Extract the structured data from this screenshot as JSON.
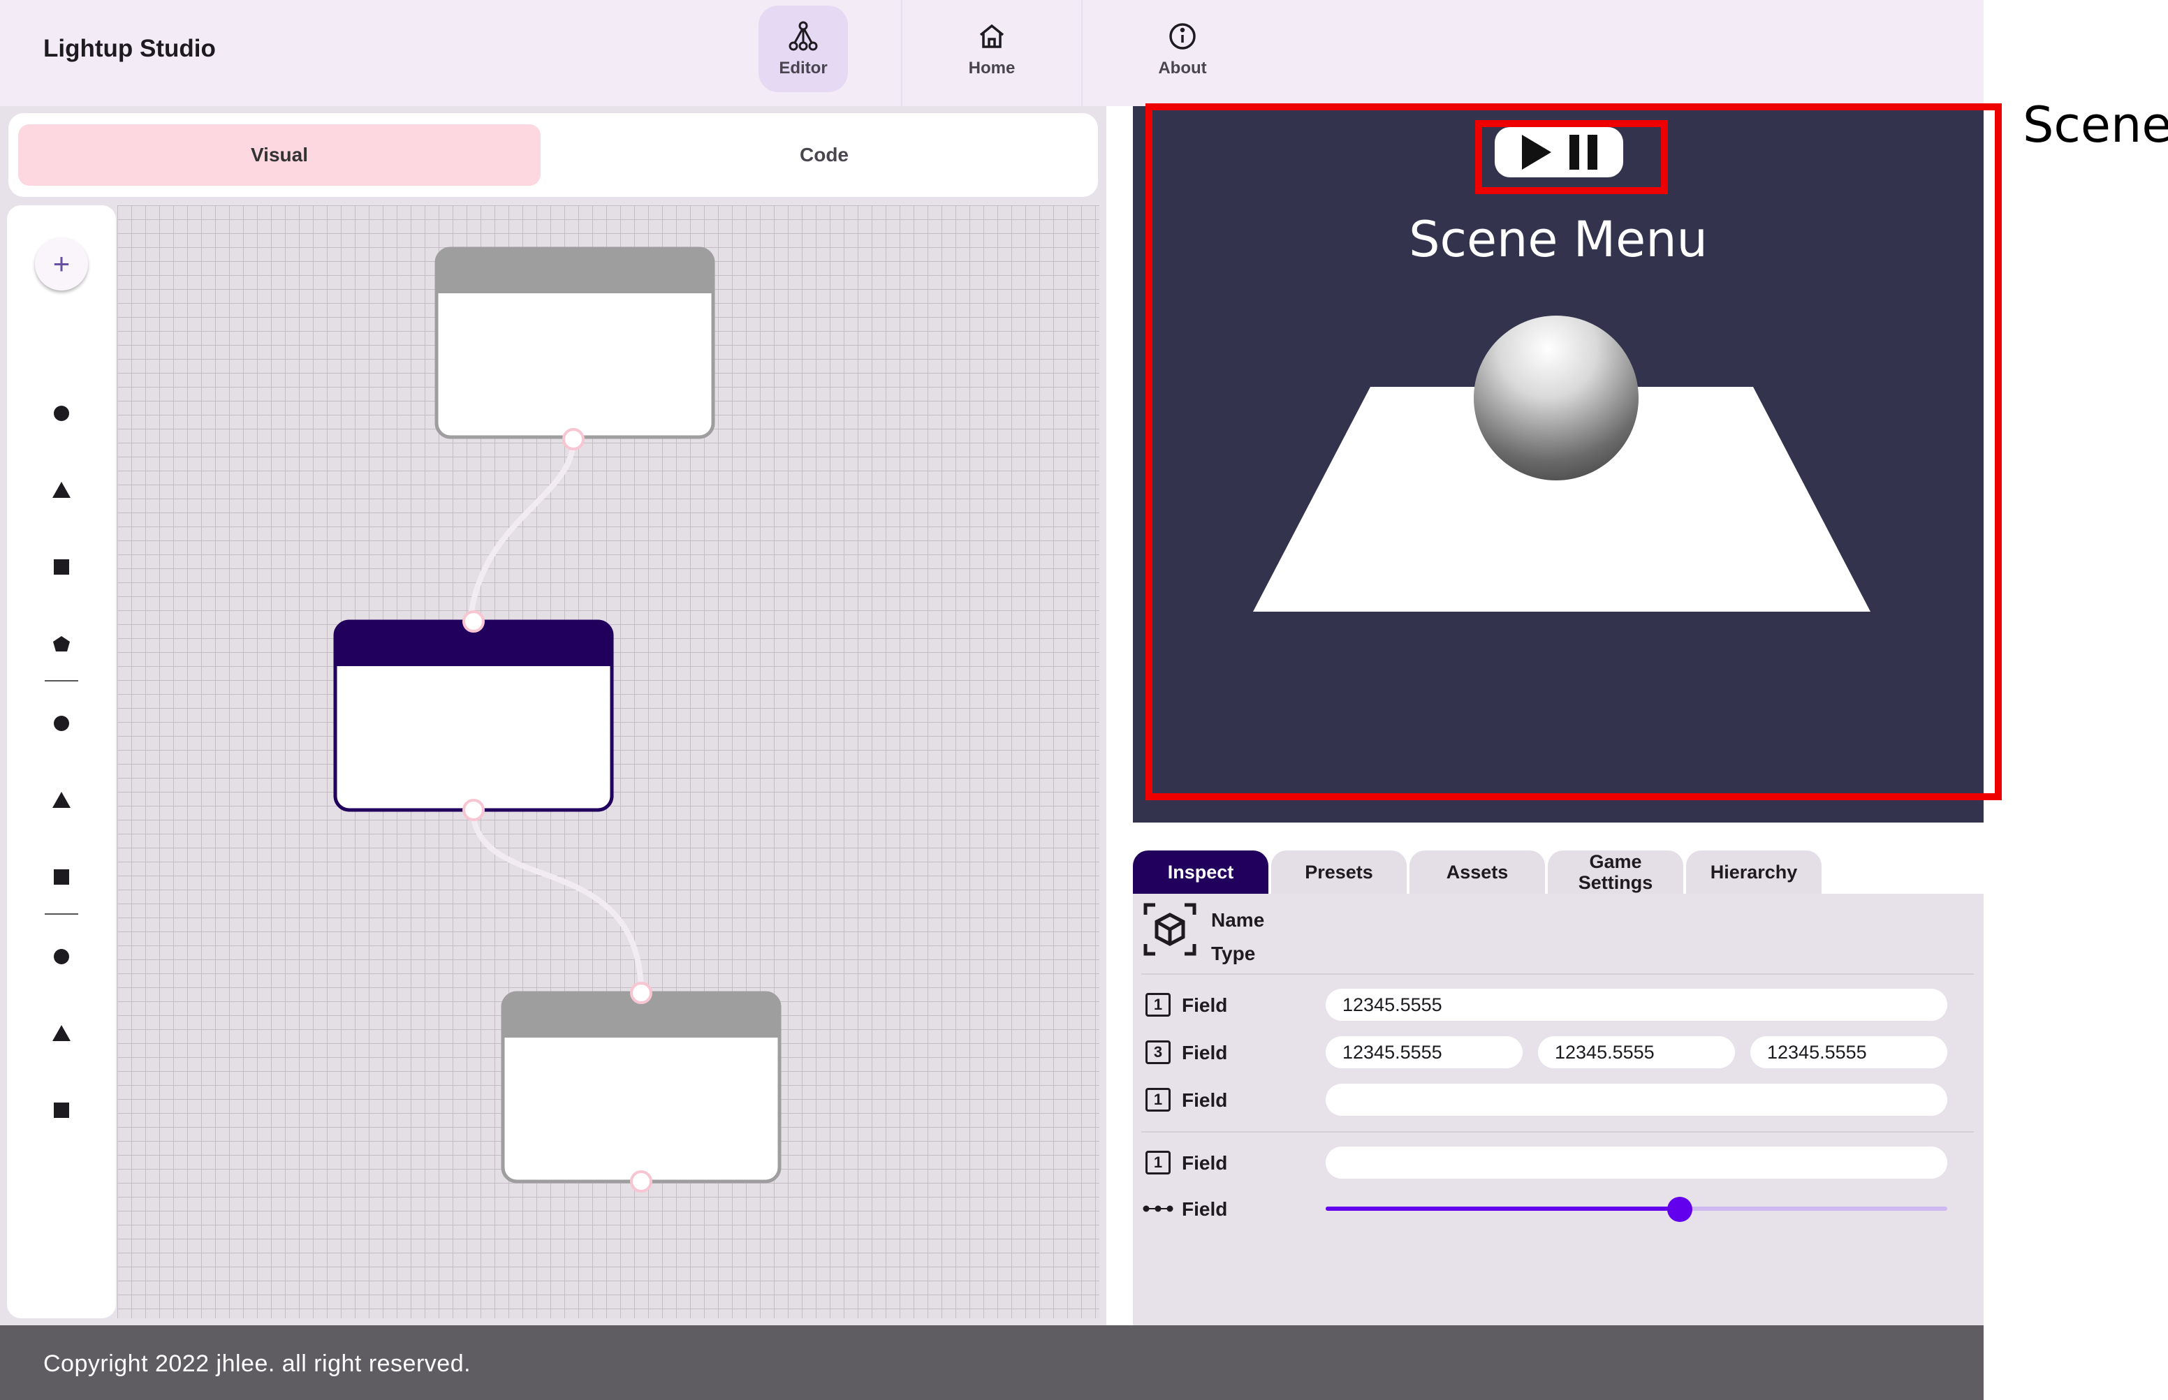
{
  "app": {
    "title": "Lightup Studio"
  },
  "nav": {
    "items": [
      {
        "label": "Editor",
        "icon": "node-tree-icon",
        "active": true
      },
      {
        "label": "Home",
        "icon": "home-icon",
        "active": false
      },
      {
        "label": "About",
        "icon": "info-icon",
        "active": false
      }
    ]
  },
  "editor": {
    "tabs": [
      {
        "label": "Visual",
        "active": true
      },
      {
        "label": "Code",
        "active": false
      }
    ],
    "add_button": "+",
    "tools": [
      {
        "group": 1,
        "icons": [
          "circle-icon",
          "triangle-icon",
          "square-icon",
          "pentagon-icon"
        ]
      },
      {
        "group": 2,
        "icons": [
          "circle-icon",
          "triangle-icon",
          "square-icon"
        ]
      },
      {
        "group": 3,
        "icons": [
          "circle-icon",
          "triangle-icon",
          "square-icon"
        ]
      }
    ],
    "graph": {
      "nodes": [
        {
          "id": "node-1",
          "selected": false
        },
        {
          "id": "node-2",
          "selected": true
        },
        {
          "id": "node-3",
          "selected": false
        }
      ],
      "connections": [
        [
          "node-1",
          "node-2"
        ],
        [
          "node-2",
          "node-3"
        ]
      ]
    }
  },
  "scene": {
    "title": "Scene Menu",
    "controls": [
      "play-icon",
      "pause-icon"
    ],
    "annotation": "Scene",
    "objects": [
      "sphere",
      "plane"
    ],
    "colors": {
      "background": "#33334d",
      "highlight": "#ee0000"
    }
  },
  "inspector": {
    "tabs": [
      {
        "label": "Inspect",
        "active": true
      },
      {
        "label": "Presets",
        "active": false
      },
      {
        "label": "Assets",
        "active": false
      },
      {
        "label": "Game Settings",
        "active": false
      },
      {
        "label": "Hierarchy",
        "active": false
      }
    ],
    "object": {
      "name_label": "Name",
      "type_label": "Type",
      "icon": "cube-icon"
    },
    "fields": [
      {
        "icon_text": "1",
        "label": "Field",
        "values": [
          "12345.5555"
        ]
      },
      {
        "icon_text": "3",
        "label": "Field",
        "values": [
          "12345.5555",
          "12345.5555",
          "12345.5555"
        ]
      },
      {
        "icon_text": "1",
        "label": "Field",
        "values": [
          ""
        ]
      },
      {
        "icon_text": "1",
        "label": "Field",
        "values": [
          ""
        ]
      },
      {
        "icon": "dots-icon",
        "label": "Field",
        "slider_value": 0.57
      }
    ]
  },
  "footer": {
    "text": "Copyright 2022 jhlee. all right reserved."
  }
}
